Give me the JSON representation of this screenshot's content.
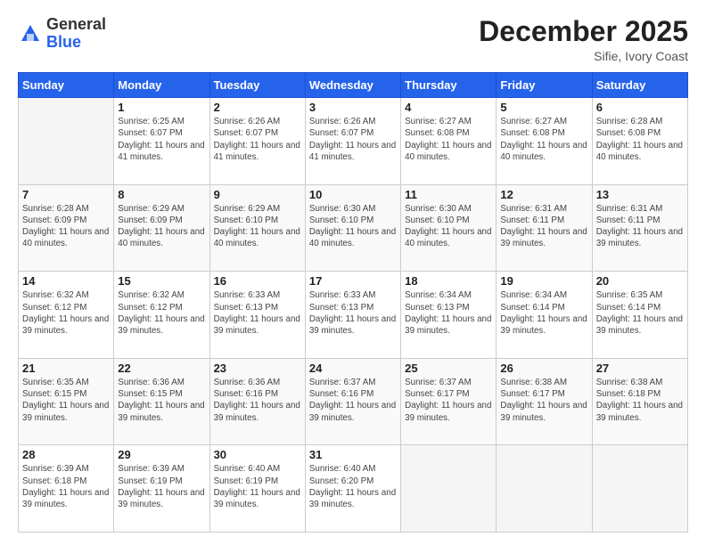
{
  "logo": {
    "general": "General",
    "blue": "Blue"
  },
  "header": {
    "title": "December 2025",
    "subtitle": "Sifie, Ivory Coast"
  },
  "columns": [
    "Sunday",
    "Monday",
    "Tuesday",
    "Wednesday",
    "Thursday",
    "Friday",
    "Saturday"
  ],
  "weeks": [
    [
      {
        "day": "",
        "sunrise": "",
        "sunset": "",
        "daylight": ""
      },
      {
        "day": "1",
        "sunrise": "Sunrise: 6:25 AM",
        "sunset": "Sunset: 6:07 PM",
        "daylight": "Daylight: 11 hours and 41 minutes."
      },
      {
        "day": "2",
        "sunrise": "Sunrise: 6:26 AM",
        "sunset": "Sunset: 6:07 PM",
        "daylight": "Daylight: 11 hours and 41 minutes."
      },
      {
        "day": "3",
        "sunrise": "Sunrise: 6:26 AM",
        "sunset": "Sunset: 6:07 PM",
        "daylight": "Daylight: 11 hours and 41 minutes."
      },
      {
        "day": "4",
        "sunrise": "Sunrise: 6:27 AM",
        "sunset": "Sunset: 6:08 PM",
        "daylight": "Daylight: 11 hours and 40 minutes."
      },
      {
        "day": "5",
        "sunrise": "Sunrise: 6:27 AM",
        "sunset": "Sunset: 6:08 PM",
        "daylight": "Daylight: 11 hours and 40 minutes."
      },
      {
        "day": "6",
        "sunrise": "Sunrise: 6:28 AM",
        "sunset": "Sunset: 6:08 PM",
        "daylight": "Daylight: 11 hours and 40 minutes."
      }
    ],
    [
      {
        "day": "7",
        "sunrise": "Sunrise: 6:28 AM",
        "sunset": "Sunset: 6:09 PM",
        "daylight": "Daylight: 11 hours and 40 minutes."
      },
      {
        "day": "8",
        "sunrise": "Sunrise: 6:29 AM",
        "sunset": "Sunset: 6:09 PM",
        "daylight": "Daylight: 11 hours and 40 minutes."
      },
      {
        "day": "9",
        "sunrise": "Sunrise: 6:29 AM",
        "sunset": "Sunset: 6:10 PM",
        "daylight": "Daylight: 11 hours and 40 minutes."
      },
      {
        "day": "10",
        "sunrise": "Sunrise: 6:30 AM",
        "sunset": "Sunset: 6:10 PM",
        "daylight": "Daylight: 11 hours and 40 minutes."
      },
      {
        "day": "11",
        "sunrise": "Sunrise: 6:30 AM",
        "sunset": "Sunset: 6:10 PM",
        "daylight": "Daylight: 11 hours and 40 minutes."
      },
      {
        "day": "12",
        "sunrise": "Sunrise: 6:31 AM",
        "sunset": "Sunset: 6:11 PM",
        "daylight": "Daylight: 11 hours and 39 minutes."
      },
      {
        "day": "13",
        "sunrise": "Sunrise: 6:31 AM",
        "sunset": "Sunset: 6:11 PM",
        "daylight": "Daylight: 11 hours and 39 minutes."
      }
    ],
    [
      {
        "day": "14",
        "sunrise": "Sunrise: 6:32 AM",
        "sunset": "Sunset: 6:12 PM",
        "daylight": "Daylight: 11 hours and 39 minutes."
      },
      {
        "day": "15",
        "sunrise": "Sunrise: 6:32 AM",
        "sunset": "Sunset: 6:12 PM",
        "daylight": "Daylight: 11 hours and 39 minutes."
      },
      {
        "day": "16",
        "sunrise": "Sunrise: 6:33 AM",
        "sunset": "Sunset: 6:13 PM",
        "daylight": "Daylight: 11 hours and 39 minutes."
      },
      {
        "day": "17",
        "sunrise": "Sunrise: 6:33 AM",
        "sunset": "Sunset: 6:13 PM",
        "daylight": "Daylight: 11 hours and 39 minutes."
      },
      {
        "day": "18",
        "sunrise": "Sunrise: 6:34 AM",
        "sunset": "Sunset: 6:13 PM",
        "daylight": "Daylight: 11 hours and 39 minutes."
      },
      {
        "day": "19",
        "sunrise": "Sunrise: 6:34 AM",
        "sunset": "Sunset: 6:14 PM",
        "daylight": "Daylight: 11 hours and 39 minutes."
      },
      {
        "day": "20",
        "sunrise": "Sunrise: 6:35 AM",
        "sunset": "Sunset: 6:14 PM",
        "daylight": "Daylight: 11 hours and 39 minutes."
      }
    ],
    [
      {
        "day": "21",
        "sunrise": "Sunrise: 6:35 AM",
        "sunset": "Sunset: 6:15 PM",
        "daylight": "Daylight: 11 hours and 39 minutes."
      },
      {
        "day": "22",
        "sunrise": "Sunrise: 6:36 AM",
        "sunset": "Sunset: 6:15 PM",
        "daylight": "Daylight: 11 hours and 39 minutes."
      },
      {
        "day": "23",
        "sunrise": "Sunrise: 6:36 AM",
        "sunset": "Sunset: 6:16 PM",
        "daylight": "Daylight: 11 hours and 39 minutes."
      },
      {
        "day": "24",
        "sunrise": "Sunrise: 6:37 AM",
        "sunset": "Sunset: 6:16 PM",
        "daylight": "Daylight: 11 hours and 39 minutes."
      },
      {
        "day": "25",
        "sunrise": "Sunrise: 6:37 AM",
        "sunset": "Sunset: 6:17 PM",
        "daylight": "Daylight: 11 hours and 39 minutes."
      },
      {
        "day": "26",
        "sunrise": "Sunrise: 6:38 AM",
        "sunset": "Sunset: 6:17 PM",
        "daylight": "Daylight: 11 hours and 39 minutes."
      },
      {
        "day": "27",
        "sunrise": "Sunrise: 6:38 AM",
        "sunset": "Sunset: 6:18 PM",
        "daylight": "Daylight: 11 hours and 39 minutes."
      }
    ],
    [
      {
        "day": "28",
        "sunrise": "Sunrise: 6:39 AM",
        "sunset": "Sunset: 6:18 PM",
        "daylight": "Daylight: 11 hours and 39 minutes."
      },
      {
        "day": "29",
        "sunrise": "Sunrise: 6:39 AM",
        "sunset": "Sunset: 6:19 PM",
        "daylight": "Daylight: 11 hours and 39 minutes."
      },
      {
        "day": "30",
        "sunrise": "Sunrise: 6:40 AM",
        "sunset": "Sunset: 6:19 PM",
        "daylight": "Daylight: 11 hours and 39 minutes."
      },
      {
        "day": "31",
        "sunrise": "Sunrise: 6:40 AM",
        "sunset": "Sunset: 6:20 PM",
        "daylight": "Daylight: 11 hours and 39 minutes."
      },
      {
        "day": "",
        "sunrise": "",
        "sunset": "",
        "daylight": ""
      },
      {
        "day": "",
        "sunrise": "",
        "sunset": "",
        "daylight": ""
      },
      {
        "day": "",
        "sunrise": "",
        "sunset": "",
        "daylight": ""
      }
    ]
  ]
}
